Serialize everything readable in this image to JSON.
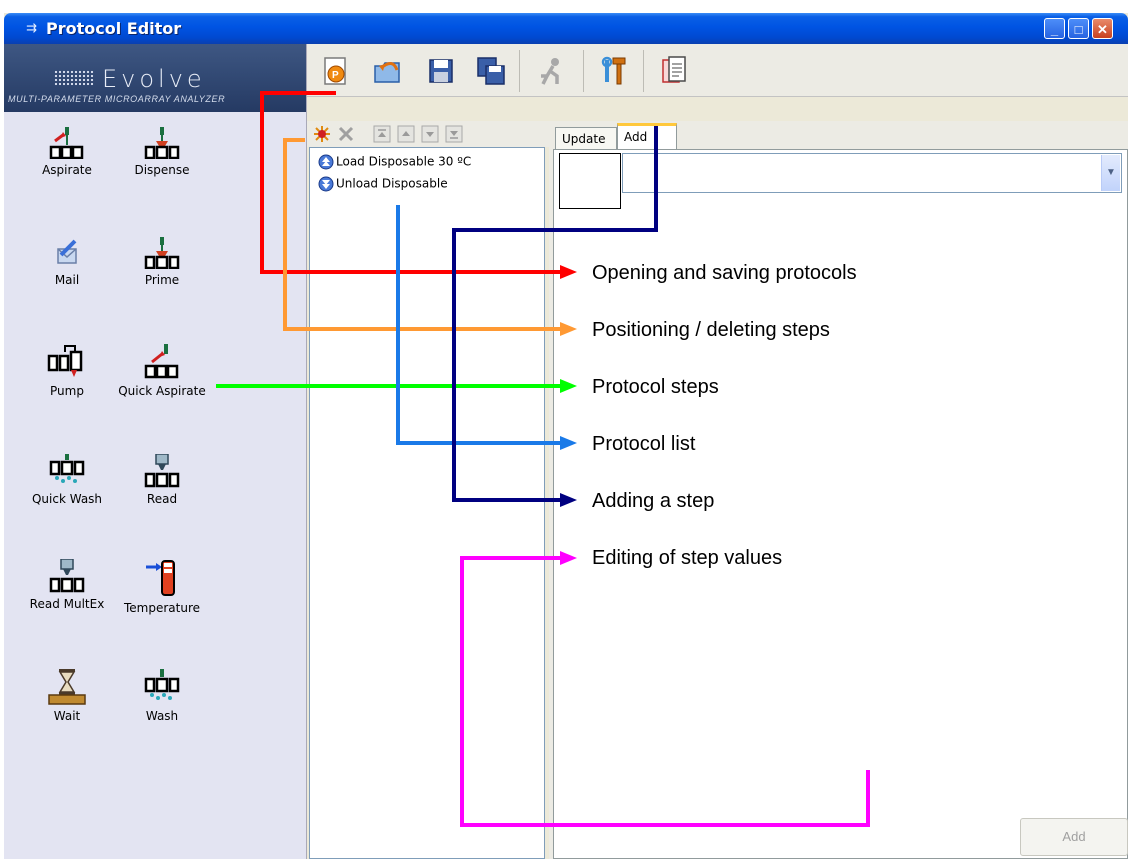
{
  "window": {
    "title": "Protocol Editor",
    "title_icon": "⇉"
  },
  "brand": {
    "name": "Evolve",
    "subtitle": "MULTI-PARAMETER MICROARRAY ANALYZER"
  },
  "tools": [
    {
      "label": "Aspirate",
      "icon": "aspirate-icon"
    },
    {
      "label": "Dispense",
      "icon": "dispense-icon"
    },
    {
      "label": "Mail",
      "icon": "mail-icon"
    },
    {
      "label": "Prime",
      "icon": "prime-icon"
    },
    {
      "label": "Pump",
      "icon": "pump-icon"
    },
    {
      "label": "Quick Aspirate",
      "icon": "quick-aspirate-icon"
    },
    {
      "label": "Quick Wash",
      "icon": "quick-wash-icon"
    },
    {
      "label": "Read",
      "icon": "read-icon"
    },
    {
      "label": "Read MultEx",
      "icon": "read-multex-icon"
    },
    {
      "label": "Temperature",
      "icon": "temperature-icon"
    },
    {
      "label": "Wait",
      "icon": "wait-icon"
    },
    {
      "label": "Wash",
      "icon": "wash-icon"
    }
  ],
  "protocol_list": [
    {
      "label": "Load Disposable 30 ºC",
      "icon": "load-icon"
    },
    {
      "label": "Unload Disposable",
      "icon": "unload-icon"
    }
  ],
  "tabs": {
    "update": "Update",
    "add": "Add"
  },
  "add_button": "Add",
  "callouts": [
    {
      "text": "Opening and saving protocols",
      "color": "#ff0000"
    },
    {
      "text": "Positioning / deleting steps",
      "color": "#ff9933"
    },
    {
      "text": "Protocol steps",
      "color": "#00ff00"
    },
    {
      "text": "Protocol list",
      "color": "#1a7ae8"
    },
    {
      "text": "Adding a step",
      "color": "#000080"
    },
    {
      "text": "Editing of step values",
      "color": "#ff00ff"
    }
  ]
}
